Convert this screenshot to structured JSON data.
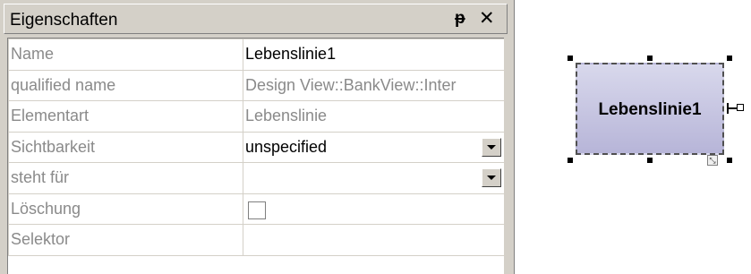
{
  "panel": {
    "title": "Eigenschaften",
    "pin_icon": "pin-icon",
    "close_icon": "close-icon"
  },
  "properties": [
    {
      "key": "Name",
      "value": "Lebenslinie1",
      "editable": true
    },
    {
      "key": "qualified name",
      "value": "Design View::BankView::Inter",
      "editable": false
    },
    {
      "key": "Elementart",
      "value": "Lebenslinie",
      "editable": false
    },
    {
      "key": "Sichtbarkeit",
      "value": "unspecified",
      "control": "dropdown"
    },
    {
      "key": "steht für",
      "value": "",
      "control": "dropdown"
    },
    {
      "key": "Löschung",
      "value": "",
      "control": "checkbox",
      "checked": false
    },
    {
      "key": "Selektor",
      "value": ""
    }
  ],
  "diagram": {
    "lifeline_label": "Lebenslinie1"
  },
  "colors": {
    "panel_bg": "#d4d0c8",
    "lifeline_fill_top": "#d8d8ec",
    "lifeline_fill_bottom": "#b7b5d8"
  }
}
